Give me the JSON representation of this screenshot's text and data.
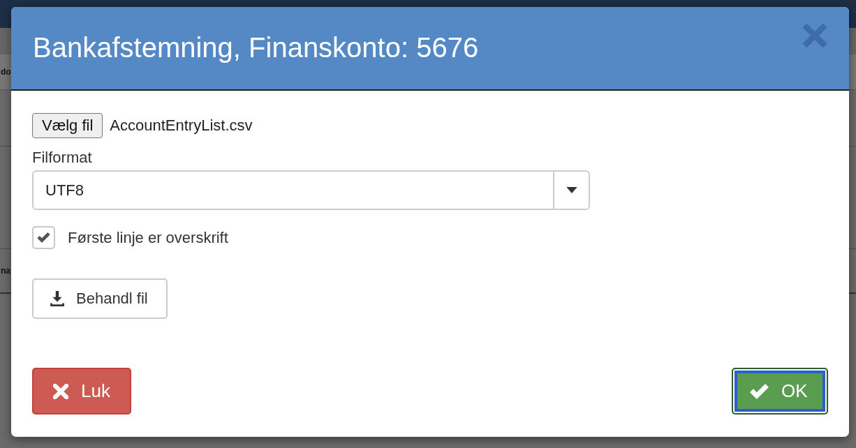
{
  "background": {
    "left_fragments": [
      "do",
      "na"
    ]
  },
  "dialog": {
    "title": "Bankafstemning, Finanskonto: 5676",
    "file_button": "Vælg fil",
    "file_name": "AccountEntryList.csv",
    "format_label": "Filformat",
    "format_select": {
      "value": "UTF8"
    },
    "header_checkbox": {
      "label": "Første linje er overskrift",
      "checked": true
    },
    "process_button": "Behandl fil",
    "close_button": "Luk",
    "ok_button": {
      "label": "OK",
      "focused": true
    }
  }
}
